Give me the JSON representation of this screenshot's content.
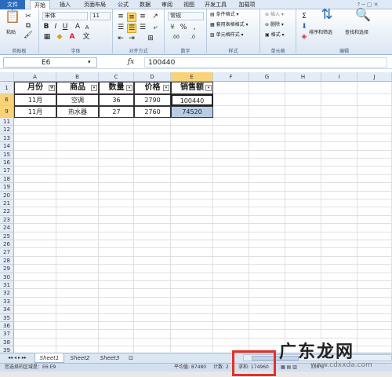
{
  "ribbon_tabs": [
    "文件",
    "开始",
    "插入",
    "页面布局",
    "公式",
    "数据",
    "审阅",
    "视图",
    "开发工具",
    "加载项"
  ],
  "clipboard": {
    "paste": "粘贴",
    "label": "剪贴板"
  },
  "font": {
    "name": "宋体",
    "size": "11",
    "bold": "B",
    "italic": "I",
    "underline": "U",
    "font_color": "A",
    "grow": "A",
    "shrink": "A",
    "label": "字体"
  },
  "alignment": {
    "label": "对齐方式"
  },
  "number": {
    "format": "常规",
    "percent": "%",
    "comma": ",",
    "decimal_inc": ".00",
    "decimal_dec": ".0",
    "label": "数字"
  },
  "styles": {
    "conditional": "条件格式",
    "table_format": "套用表格格式",
    "cell_styles": "单元格样式",
    "label": "样式"
  },
  "cells": {
    "insert": "插入",
    "delete": "删除",
    "format": "格式",
    "label": "单元格"
  },
  "editing": {
    "sigma": "Σ",
    "sort_filter": "排序和筛选",
    "find_select": "查找和选择",
    "label": "编辑"
  },
  "formula_bar": {
    "name_box": "E6",
    "fx": "fx",
    "value": "100440"
  },
  "columns": [
    "A",
    "B",
    "C",
    "D",
    "E",
    "F",
    "G",
    "H",
    "I",
    "J"
  ],
  "row_numbers": [
    "1",
    "6",
    "9",
    "11",
    "12",
    "13",
    "14",
    "15",
    "16",
    "17",
    "18",
    "19",
    "20",
    "21",
    "22",
    "23",
    "24",
    "25",
    "26",
    "27",
    "28",
    "29",
    "30",
    "31",
    "32",
    "33",
    "34",
    "35",
    "36",
    "37",
    "38",
    "39"
  ],
  "table": {
    "headers": [
      "月份",
      "商品",
      "数量",
      "价格",
      "销售额"
    ],
    "rows": [
      [
        "11月",
        "空调",
        "36",
        "2790",
        "100440"
      ],
      [
        "11月",
        "热水器",
        "27",
        "2760",
        "74520"
      ]
    ]
  },
  "sheets": [
    "Sheet1",
    "Sheet2",
    "Sheet3"
  ],
  "status": {
    "left": "您选择的区域是：E6:E9",
    "average": "平均值: 87480",
    "count": "计数: 2",
    "sum": "求和: 174960",
    "zoom": "100%"
  },
  "watermark": {
    "main": "广东龙网",
    "sub": "www.cdxxda.com"
  }
}
